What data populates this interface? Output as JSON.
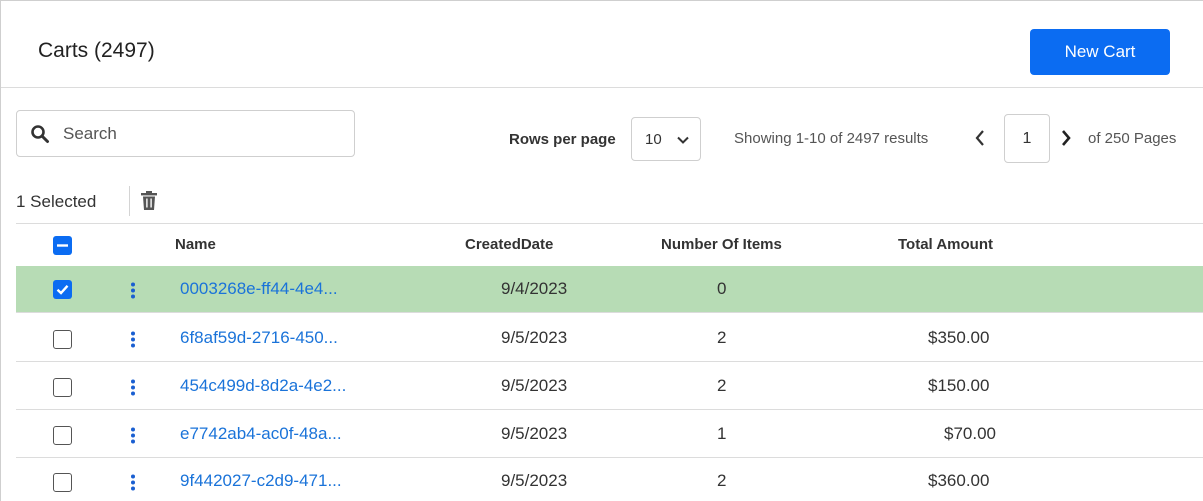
{
  "header": {
    "title": "Carts (2497)",
    "new_cart_label": "New Cart"
  },
  "search": {
    "placeholder": "Search",
    "value": ""
  },
  "pagination": {
    "rows_per_page_label": "Rows per page",
    "rows_per_page_value": "10",
    "showing_text": "Showing 1-10 of 2497 results",
    "current_page": "1",
    "total_pages_text": "of 250 Pages"
  },
  "selection": {
    "selected_text": "1 Selected"
  },
  "table": {
    "columns": [
      "Name",
      "CreatedDate",
      "Number Of Items",
      "Total Amount"
    ],
    "rows": [
      {
        "name": "0003268e-ff44-4e4...",
        "created": "9/4/2023",
        "items": "0",
        "amount": "",
        "selected": true
      },
      {
        "name": "6f8af59d-2716-450...",
        "created": "9/5/2023",
        "items": "2",
        "amount": "$350.00",
        "selected": false
      },
      {
        "name": "454c499d-8d2a-4e2...",
        "created": "9/5/2023",
        "items": "2",
        "amount": "$150.00",
        "selected": false
      },
      {
        "name": "e7742ab4-ac0f-48a...",
        "created": "9/5/2023",
        "items": "1",
        "amount": "$70.00",
        "selected": false
      },
      {
        "name": "9f442027-c2d9-471...",
        "created": "9/5/2023",
        "items": "2",
        "amount": "$360.00",
        "selected": false
      }
    ]
  },
  "colors": {
    "accent": "#0b6cf2",
    "selected_row": "#b7dcb5",
    "link": "#1a73d9"
  },
  "icons": [
    "search-icon",
    "chevron-down-icon",
    "chevron-left-icon",
    "chevron-right-icon",
    "trash-icon",
    "kebab-menu-icon",
    "checkbox-indeterminate-icon",
    "checkbox-checked-icon"
  ]
}
